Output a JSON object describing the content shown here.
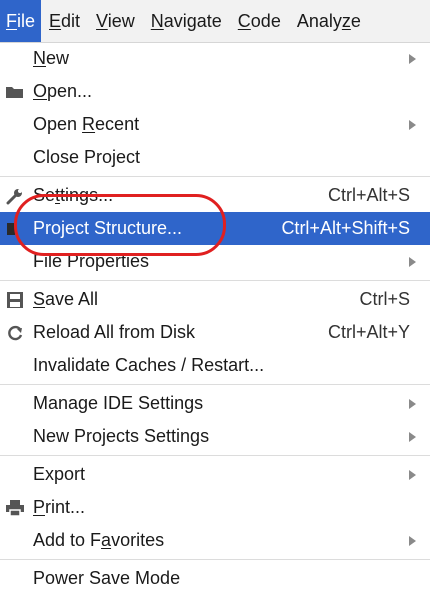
{
  "menubar": {
    "items": [
      {
        "pre": "",
        "ul": "F",
        "post": "ile"
      },
      {
        "pre": "",
        "ul": "E",
        "post": "dit"
      },
      {
        "pre": "",
        "ul": "V",
        "post": "iew"
      },
      {
        "pre": "",
        "ul": "N",
        "post": "avigate"
      },
      {
        "pre": "",
        "ul": "C",
        "post": "ode"
      },
      {
        "pre": "Analy",
        "ul": "z",
        "post": "e"
      }
    ]
  },
  "file_menu": {
    "new": {
      "pre": "",
      "ul": "N",
      "post": "ew"
    },
    "open": {
      "pre": "",
      "ul": "O",
      "post": "pen..."
    },
    "open_recent": {
      "pre": "Open ",
      "ul": "R",
      "post": "ecent"
    },
    "close_project": "Close Project",
    "settings": {
      "pre": "Se",
      "ul": "t",
      "post": "tings...",
      "shortcut": "Ctrl+Alt+S"
    },
    "project_structure": {
      "label": "Project Structure...",
      "shortcut": "Ctrl+Alt+Shift+S"
    },
    "file_properties": "File Properties",
    "save_all": {
      "pre": "",
      "ul": "S",
      "post": "ave All",
      "shortcut": "Ctrl+S"
    },
    "reload": {
      "label": "Reload All from Disk",
      "shortcut": "Ctrl+Alt+Y"
    },
    "invalidate": "Invalidate Caches / Restart...",
    "manage_ide": "Manage IDE Settings",
    "new_projects": "New Projects Settings",
    "export": "Export",
    "print": {
      "pre": "",
      "ul": "P",
      "post": "rint..."
    },
    "favorites": {
      "pre": "Add to F",
      "ul": "a",
      "post": "vorites"
    },
    "power_save": "Power Save Mode"
  },
  "colors": {
    "selection": "#2f65ca",
    "annotation": "#e02020"
  }
}
